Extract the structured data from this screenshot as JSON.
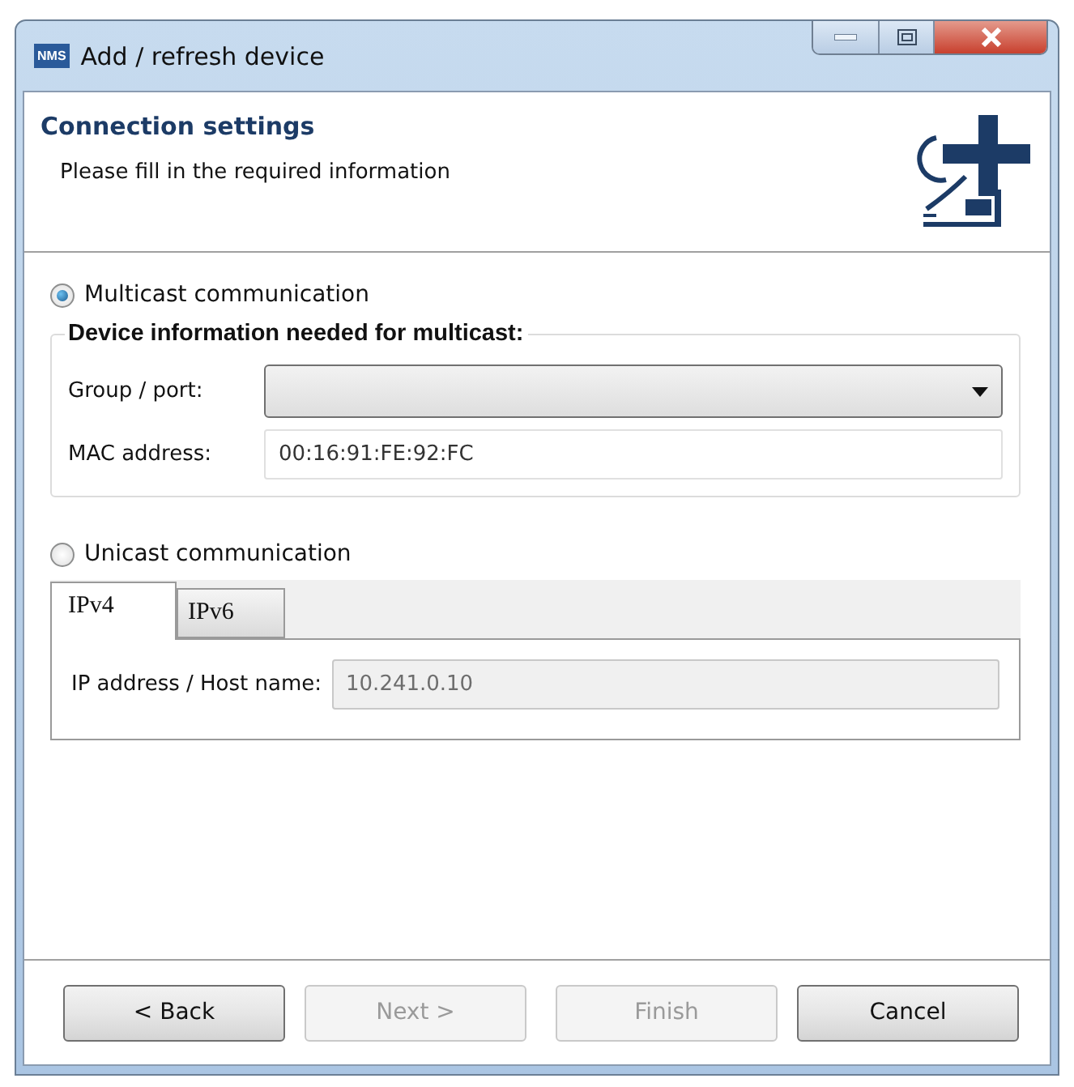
{
  "window": {
    "title": "Add / refresh device",
    "app_badge": "NMS"
  },
  "header": {
    "title": "Connection settings",
    "subtitle": "Please fill in the required information"
  },
  "multicast": {
    "label": "Multicast communication",
    "selected": true,
    "group_title": "Device information needed for multicast:",
    "fields": [
      {
        "kind": "dropdown",
        "label": "Group / port:"
      },
      {
        "kind": "text",
        "label": "MAC address:",
        "value": "00:16:91:FE:92:FC",
        "disabled": false
      }
    ]
  },
  "unicast": {
    "label": "Unicast communication",
    "selected": false,
    "tabs": [
      {
        "label": "IPv4",
        "selected": true
      },
      {
        "label": "IPv6",
        "selected": false
      }
    ],
    "fields": [
      {
        "kind": "text",
        "label": "IP address / Host name:",
        "value": "10.241.0.10",
        "disabled": true
      }
    ]
  },
  "buttons": [
    {
      "label": "< Back",
      "disabled": false
    },
    {
      "label": "Next >",
      "disabled": true
    },
    {
      "label": "Finish",
      "disabled": true
    },
    {
      "label": "Cancel",
      "disabled": false
    }
  ]
}
